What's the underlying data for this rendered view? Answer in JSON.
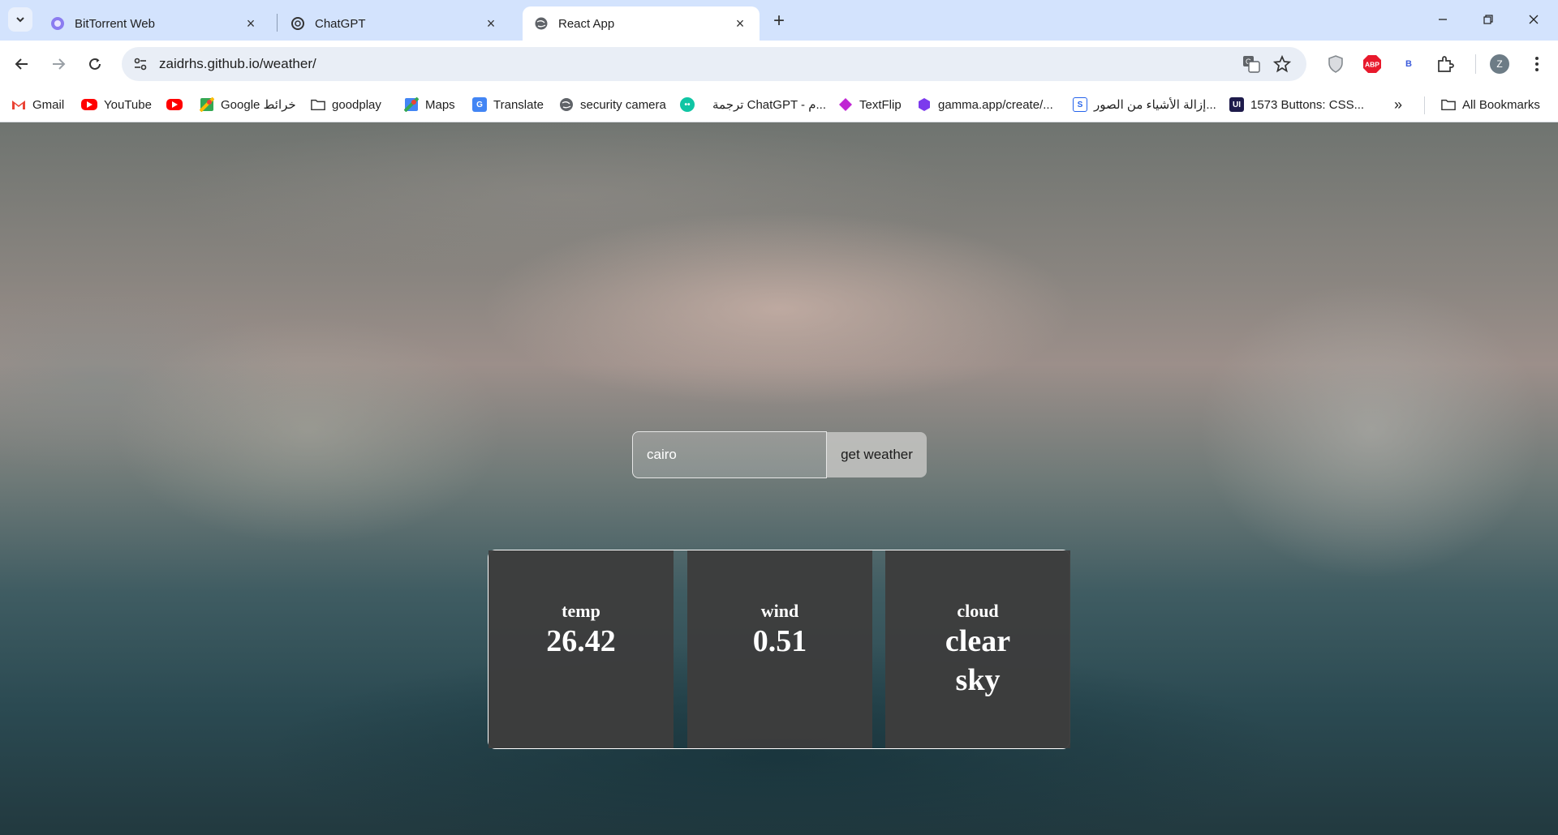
{
  "browser": {
    "tabs": [
      {
        "title": "BitTorrent Web",
        "icon": "bittorrent-icon",
        "active": false
      },
      {
        "title": "ChatGPT",
        "icon": "chatgpt-icon",
        "active": false
      },
      {
        "title": "React App",
        "icon": "globe-icon",
        "active": true
      }
    ],
    "url": "zaidrhs.github.io/weather/",
    "profile_initial": "Z",
    "extension_abp": "ABP",
    "extension_b": "B"
  },
  "bookmarks": {
    "items": [
      {
        "label": "Gmail",
        "icon": "gmail-icon"
      },
      {
        "label": "YouTube",
        "icon": "youtube-icon"
      },
      {
        "label": "",
        "icon": "youtube-icon"
      },
      {
        "label": "Google خرائط",
        "icon": "google-maps-icon"
      },
      {
        "label": "goodplay",
        "icon": "folder-icon"
      },
      {
        "label": "Maps",
        "icon": "maps-icon"
      },
      {
        "label": "Translate",
        "icon": "translate-icon"
      },
      {
        "label": "security camera",
        "icon": "globe-icon"
      },
      {
        "label": "",
        "icon": "chat-bubble-icon"
      },
      {
        "label": "ترجمة ChatGPT - م...",
        "icon": ""
      },
      {
        "label": "TextFlip",
        "icon": "textflip-icon"
      },
      {
        "label": "gamma.app/create/...",
        "icon": "gamma-icon"
      },
      {
        "label": "إزالة الأشياء من الصور...",
        "icon": "s-icon"
      },
      {
        "label": "1573 Buttons: CSS...",
        "icon": "ui-icon"
      }
    ],
    "all_bookmarks": "All Bookmarks"
  },
  "weather_app": {
    "city_value": "cairo",
    "button_label": "get weather",
    "cards": [
      {
        "label": "temp",
        "value": "26.42"
      },
      {
        "label": "wind",
        "value": "0.51"
      },
      {
        "label": "cloud",
        "value": "clear sky"
      }
    ]
  }
}
